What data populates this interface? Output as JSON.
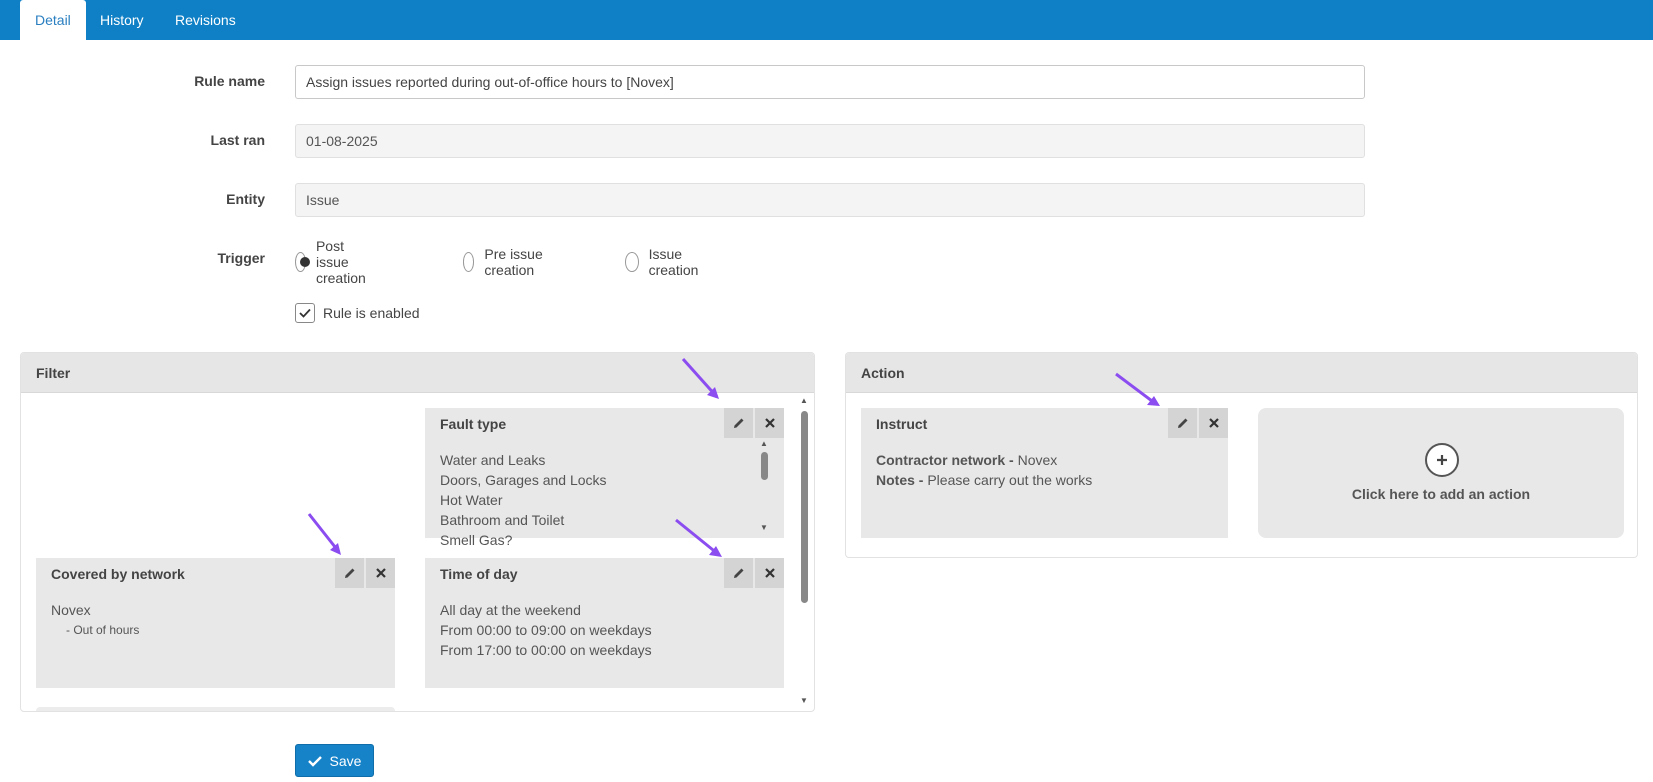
{
  "tabs": [
    {
      "label": "Detail"
    },
    {
      "label": "History"
    },
    {
      "label": "Revisions"
    }
  ],
  "form": {
    "rule_name_label": "Rule name",
    "rule_name_value": "Assign issues reported during out-of-office hours to [Novex]",
    "last_ran_label": "Last ran",
    "last_ran_value": "01-08-2025",
    "entity_label": "Entity",
    "entity_value": "Issue",
    "trigger_label": "Trigger",
    "trigger_options": [
      {
        "label": "Post issue creation",
        "selected": true
      },
      {
        "label": "Pre issue creation",
        "selected": false
      },
      {
        "label": "Issue creation",
        "selected": false
      }
    ],
    "enabled_label": "Rule is enabled",
    "enabled_checked": true
  },
  "filter": {
    "title": "Filter",
    "fault_type": {
      "title": "Fault type",
      "items": [
        "Water and Leaks",
        "Doors, Garages and Locks",
        "Hot Water",
        "Bathroom and Toilet",
        "Smell Gas?"
      ]
    },
    "covered_by_network": {
      "title": "Covered by network",
      "network": "Novex",
      "sub": "- Out of hours"
    },
    "time_of_day": {
      "title": "Time of day",
      "items": [
        "All day at the weekend",
        "From 00:00 to 09:00 on weekdays",
        "From 17:00 to 00:00 on weekdays"
      ]
    }
  },
  "action": {
    "title": "Action",
    "instruct": {
      "title": "Instruct",
      "contractor_label": "Contractor network -",
      "contractor_value": "Novex",
      "notes_label": "Notes -",
      "notes_value": "Please carry out the works"
    },
    "add_label": "Click here to add an action"
  },
  "save_label": "Save",
  "icons": {
    "edit": "pencil-icon",
    "delete": "close-icon",
    "add": "plus-icon",
    "save": "check-icon"
  },
  "colors": {
    "topbar": "#0f80c6",
    "annotation_arrow": "#8b4cf0",
    "save_button": "#1682c8"
  }
}
